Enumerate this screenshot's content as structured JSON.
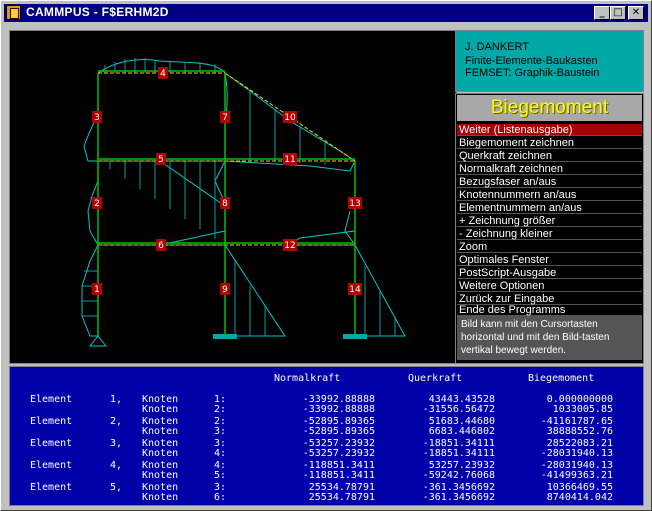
{
  "window": {
    "title": "CAMMPUS - F$ERHM2D",
    "min_glyph": "_",
    "max_glyph": "□",
    "close_glyph": "✕"
  },
  "info": {
    "line1": "J. DANKERT",
    "line2": "Finite-Elemente-Baukasten",
    "line3": "FEMSET:  Graphik-Baustein"
  },
  "menu": {
    "title": "Biegemoment",
    "items": [
      {
        "label": "Weiter (Listenausgabe)"
      },
      {
        "label": "Biegemoment zeichnen"
      },
      {
        "label": "Querkraft zeichnen"
      },
      {
        "label": "Normalkraft zeichnen"
      },
      {
        "label": "Bezugsfaser an/aus"
      },
      {
        "label": "Knotennummern  an/aus"
      },
      {
        "label": "Elementnummern an/aus"
      },
      {
        "label": "+ Zeichnung größer"
      },
      {
        "label": "- Zeichnung kleiner"
      },
      {
        "label": "Zoom"
      },
      {
        "label": "Optimales Fenster"
      },
      {
        "label": "PostScript-Ausgabe"
      },
      {
        "label": "Weitere Optionen"
      },
      {
        "label": "Zurück zur Eingabe"
      },
      {
        "label": "Ende des Programms"
      }
    ],
    "help": "Bild kann mit den Cursortasten horizontal und mit den Bild-tasten vertikal bewegt werden."
  },
  "element_labels": [
    "1",
    "2",
    "3",
    "4",
    "5",
    "6",
    "7",
    "8",
    "9",
    "10",
    "11",
    "12",
    "13",
    "14"
  ],
  "table": {
    "headers": {
      "normal": "Normalkraft",
      "shear": "Querkraft",
      "moment": "Biegemoment"
    },
    "elements": [
      {
        "label": "Element",
        "num": "1,",
        "rows": [
          {
            "knoten": "Knoten",
            "node": "1:",
            "n": "-33992.88888",
            "q": "43443.43528",
            "m": "0.000000000"
          },
          {
            "knoten": "Knoten",
            "node": "2:",
            "n": "-33992.88888",
            "q": "-31556.56472",
            "m": "1033005.85"
          }
        ]
      },
      {
        "label": "Element",
        "num": "2,",
        "rows": [
          {
            "knoten": "Knoten",
            "node": "2:",
            "n": "-52895.89365",
            "q": "51683.44680",
            "m": "-41161787.65"
          },
          {
            "knoten": "Knoten",
            "node": "3:",
            "n": "-52895.89365",
            "q": "6683.446802",
            "m": "38888552.76"
          }
        ]
      },
      {
        "label": "Element",
        "num": "3,",
        "rows": [
          {
            "knoten": "Knoten",
            "node": "3:",
            "n": "-53257.23932",
            "q": "-18851.34111",
            "m": "28522083.21"
          },
          {
            "knoten": "Knoten",
            "node": "4:",
            "n": "-53257.23932",
            "q": "-18851.34111",
            "m": "-28031940.13"
          }
        ]
      },
      {
        "label": "Element",
        "num": "4,",
        "rows": [
          {
            "knoten": "Knoten",
            "node": "4:",
            "n": "-118851.3411",
            "q": "53257.23932",
            "m": "-28031940.13"
          },
          {
            "knoten": "Knoten",
            "node": "5:",
            "n": "-118851.3411",
            "q": "-59242.76068",
            "m": "-41499363.21"
          }
        ]
      },
      {
        "label": "Element",
        "num": "5,",
        "rows": [
          {
            "knoten": "Knoten",
            "node": "3:",
            "n": "25534.78791",
            "q": "-361.3456692",
            "m": "10366469.55"
          },
          {
            "knoten": "Knoten",
            "node": "6:",
            "n": "25534.78791",
            "q": "-361.3456692",
            "m": "8740414.042"
          }
        ]
      }
    ]
  }
}
